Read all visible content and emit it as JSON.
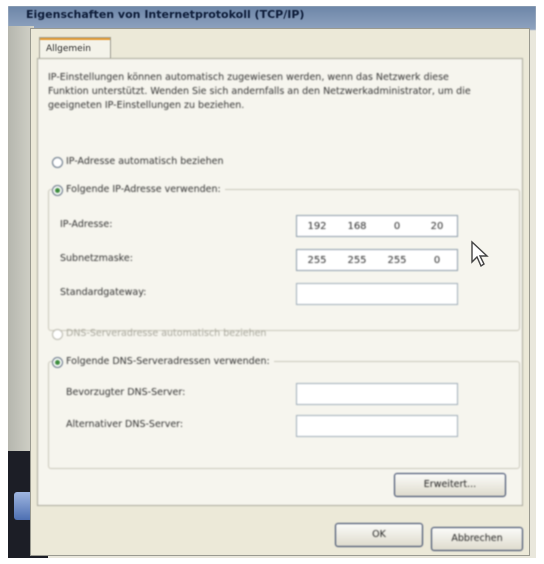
{
  "window": {
    "title": "Eigenschaften von Internetprotokoll (TCP/IP)"
  },
  "tabs": [
    {
      "label": "Allgemein"
    }
  ],
  "intro_text": "IP-Einstellungen können automatisch zugewiesen werden, wenn das Netzwerk diese Funktion unterstützt. Wenden Sie sich andernfalls an den Netzwerkadministrator, um die geeigneten IP-Einstellungen zu beziehen.",
  "ip_section": {
    "auto_label": "IP-Adresse automatisch beziehen",
    "manual_label": "Folgende IP-Adresse verwenden:",
    "selected": "manual",
    "fields": [
      {
        "label": "IP-Adresse:",
        "octets": [
          "192",
          "168",
          "0",
          "20"
        ]
      },
      {
        "label": "Subnetzmaske:",
        "octets": [
          "255",
          "255",
          "255",
          "0"
        ]
      },
      {
        "label": "Standardgateway:",
        "octets": [
          "",
          "",
          "",
          ""
        ]
      }
    ]
  },
  "dns_section": {
    "auto_label": "DNS-Serveradresse automatisch beziehen",
    "manual_label": "Folgende DNS-Serveradressen verwenden:",
    "selected": "manual",
    "auto_disabled": true,
    "fields": [
      {
        "label": "Bevorzugter DNS-Server:",
        "octets": [
          "",
          "",
          "",
          ""
        ]
      },
      {
        "label": "Alternativer DNS-Server:",
        "octets": [
          "",
          "",
          "",
          ""
        ]
      }
    ]
  },
  "buttons": {
    "advanced": "Erweitert...",
    "ok": "OK",
    "cancel": "Abbrechen"
  },
  "colors": {
    "selection_dot": "#3c8b3c",
    "tab_accent": "#e59a2f",
    "dialog_bg": "#ece9d8"
  },
  "icons": {
    "cursor": "mouse-pointer-icon",
    "desktop": "desktop-shortcut-icon"
  }
}
